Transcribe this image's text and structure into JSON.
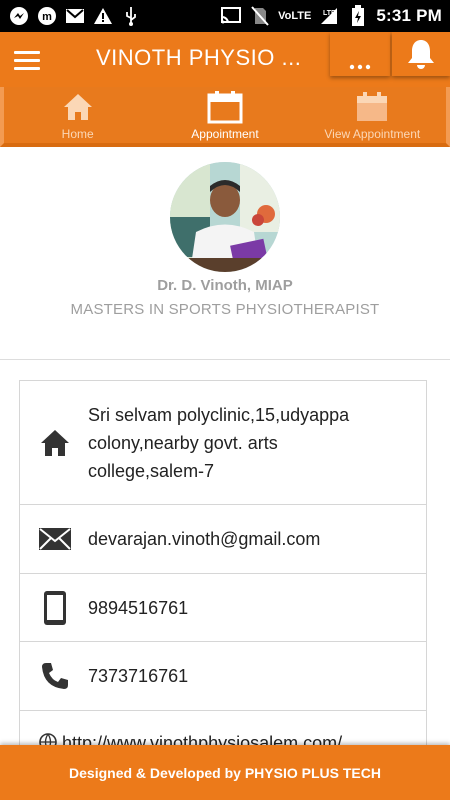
{
  "status_bar": {
    "time": "5:31 PM",
    "network_label": "VoLTE",
    "lte_label": "LTE"
  },
  "app_bar": {
    "title": "VINOTH PHYSIO ...",
    "more_label": "..."
  },
  "tabs": [
    {
      "label": "Home",
      "icon": "home-icon",
      "active": false
    },
    {
      "label": "Appointment",
      "icon": "calendar-icon",
      "active": true
    },
    {
      "label": "View Appointment",
      "icon": "calendar-view-icon",
      "active": false
    }
  ],
  "profile": {
    "name": "Dr. D. Vinoth, MIAP",
    "title": "MASTERS IN SPORTS PHYSIOTHERAPIST"
  },
  "contact": {
    "address_lines": [
      "Sri selvam polyclinic,15,udyappa",
      "colony,nearby govt. arts",
      "college,salem-7"
    ],
    "email": "devarajan.vinoth@gmail.com",
    "mobile": "9894516761",
    "phone": "7373716761",
    "website": "http://www.vinothphysiosalem.com/"
  },
  "footer": {
    "text": "Designed & Developed by PHYSIO PLUS TECH"
  },
  "colors": {
    "primary": "#ec7a1a",
    "tab_inactive": "#fbd7b6",
    "muted_text": "#9e9e9e"
  }
}
